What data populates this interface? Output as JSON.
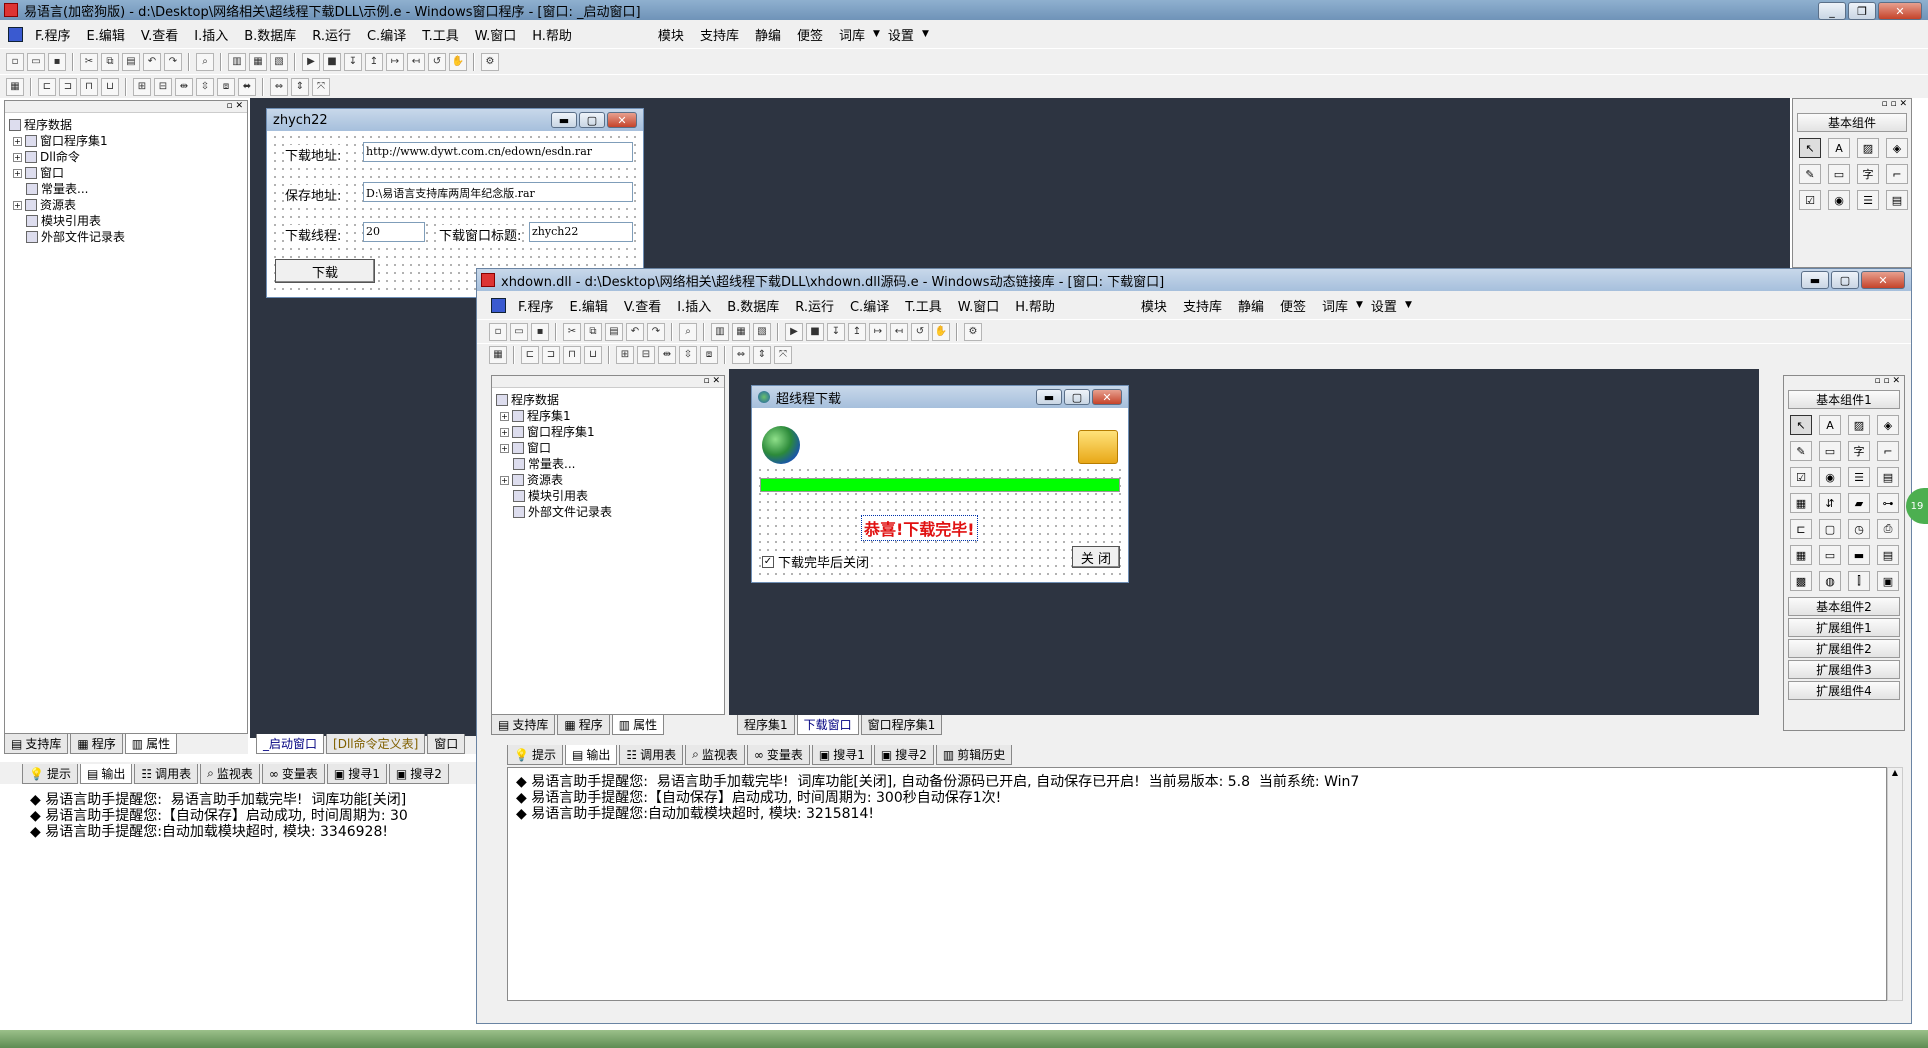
{
  "outer": {
    "title": "易语言(加密狗版) - d:\\Desktop\\网络相关\\超线程下载DLL\\示例.e - Windows窗口程序 - [窗口: _启动窗口]",
    "menu": [
      "F.程序",
      "E.编辑",
      "V.查看",
      "I.插入",
      "B.数据库",
      "R.运行",
      "C.编译",
      "T.工具",
      "W.窗口",
      "H.帮助"
    ],
    "menu_right": [
      "模块",
      "支持库",
      "静编",
      "便签",
      "词库",
      "设置"
    ],
    "tree": {
      "root": "程序数据",
      "items": [
        "窗口程序集1",
        "Dll命令",
        "窗口",
        "常量表...",
        "资源表",
        "模块引用表",
        "外部文件记录表"
      ]
    },
    "left_tabs": [
      "支持库",
      "程序",
      "属性"
    ],
    "doc_tabs": [
      "_启动窗口",
      "[Dll命令定义表]",
      "窗口"
    ],
    "bottom_tabs": [
      "提示",
      "输出",
      "调用表",
      "监视表",
      "变量表",
      "搜寻1",
      "搜寻2"
    ],
    "output_lines": [
      "◆ 易语言助手提醒您:  易语言助手加载完毕!  词库功能[关闭]",
      "",
      "◆ 易语言助手提醒您:【自动保存】启动成功, 时间周期为: 30",
      "◆ 易语言助手提醒您:自动加载模块超时, 模块: 3346928!"
    ],
    "components_header": "基本组件"
  },
  "form1": {
    "title": "zhych22",
    "download_label": "下载地址:",
    "download_value": "http://www.dywt.com.cn/edown/esdn.rar",
    "save_label": "保存地址:",
    "save_value": "D:\\易语言支持库两周年纪念版.rar",
    "threads_label": "下载线程:",
    "threads_value": "20",
    "wintitle_label": "下载窗口标题:",
    "wintitle_value": "zhych22",
    "button": "下载"
  },
  "inner": {
    "title": "xhdown.dll - d:\\Desktop\\网络相关\\超线程下载DLL\\xhdown.dll源码.e - Windows动态链接库 - [窗口: 下载窗口]",
    "menu": [
      "F.程序",
      "E.编辑",
      "V.查看",
      "I.插入",
      "B.数据库",
      "R.运行",
      "C.编译",
      "T.工具",
      "W.窗口",
      "H.帮助"
    ],
    "menu_right": [
      "模块",
      "支持库",
      "静编",
      "便签",
      "词库",
      "设置"
    ],
    "tree": {
      "root": "程序数据",
      "items": [
        "程序集1",
        "窗口程序集1",
        "窗口",
        "常量表...",
        "资源表",
        "模块引用表",
        "外部文件记录表"
      ]
    },
    "left_tabs": [
      "支持库",
      "程序",
      "属性"
    ],
    "doc_tabs": [
      "程序集1",
      "下载窗口",
      "窗口程序集1"
    ],
    "bottom_tabs": [
      "提示",
      "输出",
      "调用表",
      "监视表",
      "变量表",
      "搜寻1",
      "搜寻2",
      "剪辑历史"
    ],
    "output_lines": [
      "◆ 易语言助手提醒您:  易语言助手加载完毕!  词库功能[关闭], 自动备份源码已开启, 自动保存已开启!  当前易版本: 5.8  当前系统: Win7",
      "",
      "◆ 易语言助手提醒您:【自动保存】启动成功, 时间周期为: 300秒自动保存1次!",
      "◆ 易语言助手提醒您:自动加载模块超时, 模块: 3215814!"
    ],
    "components_header": "基本组件1",
    "component_categories": [
      "基本组件2",
      "扩展组件1",
      "扩展组件2",
      "扩展组件3",
      "扩展组件4"
    ]
  },
  "form2": {
    "title": "超线程下载",
    "progress": 1.0,
    "message": "恭喜!下载完毕!",
    "checkbox_label": "下载完毕后关闭",
    "checkbox_checked": true,
    "close_button": "关 闭"
  },
  "colors": {
    "workspace": "#2d3441",
    "progress": "#00ff00",
    "message": "#e01010"
  }
}
